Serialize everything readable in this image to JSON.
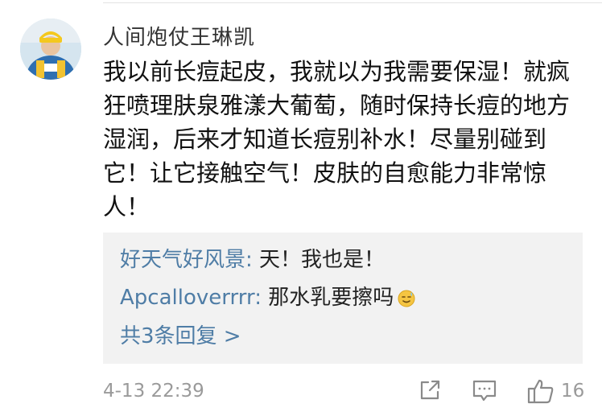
{
  "comment": {
    "author": "人间炮仗王琳凯",
    "text": "我以前长痘起皮，我就以为我需要保湿！就疯狂喷理肤泉雅漾大葡萄，随时保持长痘的地方湿润，后来才知道长痘别补水！尽量别碰到它！让它接触空气！皮肤的自愈能力非常惊人！",
    "timestamp": "4-13 22:39",
    "like_count": "16"
  },
  "replies": [
    {
      "author": "好天气好风景",
      "separator": ": ",
      "text": "天！我也是！"
    },
    {
      "author": "Apcalloverrrr",
      "separator": ": ",
      "text": "那水乳要擦吗",
      "emoji": "sweat-smile-emoji"
    }
  ],
  "more_replies_label": "共3条回复 >",
  "actions": {
    "share_icon": "share-icon",
    "comment_icon": "comment-icon",
    "like_icon": "thumbs-up-icon"
  },
  "colors": {
    "link_blue": "#4f7da6",
    "reply_bg": "#f2f2f2",
    "meta_gray": "#9a9a9a"
  }
}
